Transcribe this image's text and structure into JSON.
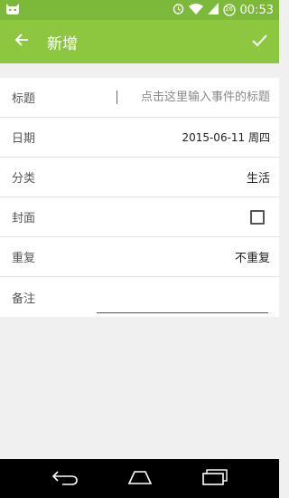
{
  "status_bar": {
    "time": "00:53",
    "battery_level": "26",
    "icons": [
      "cat-face-icon",
      "alarm-icon",
      "wifi-icon",
      "signal-icon",
      "battery-icon"
    ]
  },
  "app_bar": {
    "title": "新增",
    "back_icon": "arrow-left-icon",
    "confirm_icon": "check-icon",
    "color": "#8dc63f"
  },
  "form": {
    "title": {
      "label": "标题",
      "placeholder": "点击这里输入事件的标题",
      "value": ""
    },
    "date": {
      "label": "日期",
      "value": "2015-06-11 周四"
    },
    "category": {
      "label": "分类",
      "value": "生活"
    },
    "cover": {
      "label": "封面",
      "checked": false
    },
    "repeat": {
      "label": "重复",
      "value": "不重复"
    },
    "note": {
      "label": "备注",
      "value": ""
    }
  },
  "nav_bar": {
    "icons": [
      "back-nav-icon",
      "home-nav-icon",
      "recents-nav-icon"
    ]
  }
}
